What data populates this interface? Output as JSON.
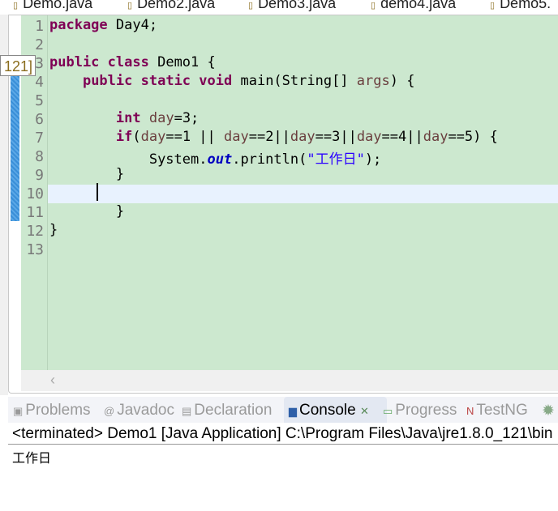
{
  "editor_tabs": [
    {
      "label": "Demo.java"
    },
    {
      "label": "Demo2.java"
    },
    {
      "label": "Demo3.java"
    },
    {
      "label": "demo4.java"
    },
    {
      "label": "Demo5."
    }
  ],
  "tooltip": "121]",
  "line_numbers": [
    "1",
    "2",
    "3",
    "4",
    "5",
    "6",
    "7",
    "8",
    "9",
    "10",
    "11",
    "12",
    "13"
  ],
  "code": {
    "package_kw": "package",
    "package_name": " Day4;",
    "public": "public",
    "class": "class",
    "class_name": " Demo1 {",
    "static": "static",
    "void": "void",
    "main_sig": " main(String[] ",
    "args": "args",
    ") {": ") {",
    "int": "int",
    "day": "day",
    "assign": "=3;",
    "if": "if",
    "open": "(",
    "eq1": "==1 || ",
    "eq2": "==2||",
    "eq3": "==3||",
    "eq4": "==4||",
    "eq5": "==5) {",
    "sys": "System.",
    "out": "out",
    "println": ".println(",
    "str": "\"工作日\"",
    "close": ");",
    "brace": "}"
  },
  "current_line": 10,
  "bottom_tabs": [
    {
      "label": "Problems"
    },
    {
      "label": "Javadoc"
    },
    {
      "label": "Declaration"
    },
    {
      "label": "Console",
      "active": true
    },
    {
      "label": "Progress"
    },
    {
      "label": "TestNG"
    }
  ],
  "console": {
    "header": "<terminated> Demo1 [Java Application] C:\\Program Files\\Java\\jre1.8.0_121\\bin",
    "output": "工作日"
  },
  "colors": {
    "editor_bg": "#cce8cf",
    "current_line": "#e8f2fe",
    "keyword": "#7f0055",
    "string": "#2a00ff"
  }
}
